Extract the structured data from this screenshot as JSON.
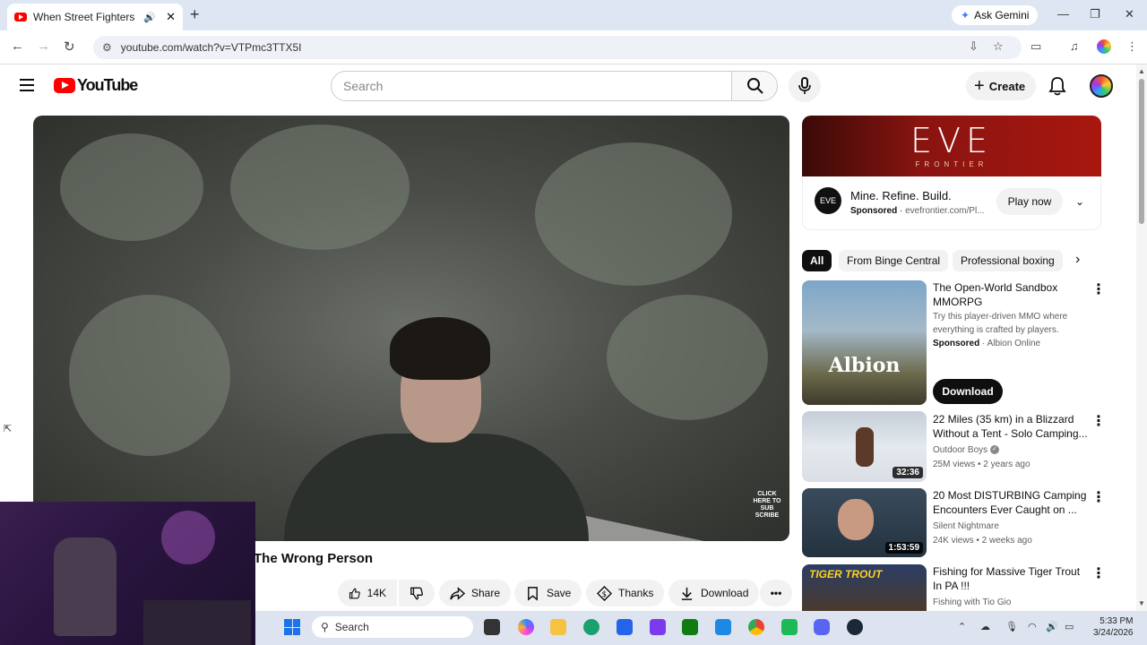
{
  "browser": {
    "tab_title": "When Street Fighters Mess",
    "tab_audio": "🔊",
    "tab_close": "✕",
    "new_tab": "+",
    "ask_gemini": "Ask Gemini",
    "url": "youtube.com/watch?v=VTPmc3TTX5I",
    "window_min": "—",
    "window_max": "❐",
    "window_close": "✕"
  },
  "youtube": {
    "logo_text": "YouTube",
    "search_placeholder": "Search",
    "create_label": "Create"
  },
  "video": {
    "title": "The Wrong Person",
    "watermark": "CLICK HERE TO SUB SCRIBE",
    "actions": {
      "likes": "14K",
      "share": "Share",
      "save": "Save",
      "thanks": "Thanks",
      "download": "Download"
    }
  },
  "ad": {
    "banner_title": "EVE",
    "banner_subtitle": "FRONTIER",
    "logo": "EVE",
    "headline": "Mine. Refine. Build.",
    "sponsored": "Sponsored",
    "domain": "evefrontier.com/Pl...",
    "cta": "Play now"
  },
  "chips": [
    "All",
    "From Binge Central",
    "Professional boxing"
  ],
  "recommendations": [
    {
      "title": "The Open-World Sandbox MMORPG",
      "description": "Try this player-driven MMO where everything is crafted by players.",
      "sponsored": "Sponsored",
      "advertiser": "Albion Online",
      "thumb_text": "Albion",
      "cta": "Download"
    },
    {
      "title": "22 Miles (35 km) in a Blizzard Without a Tent - Solo Camping...",
      "channel": "Outdoor Boys",
      "meta": "25M views • 2 years ago",
      "duration": "32:36"
    },
    {
      "title": "20 Most DISTURBING Camping Encounters Ever Caught on ...",
      "channel": "Silent Nightmare",
      "meta": "24K views • 2 weeks ago",
      "duration": "1:53:59"
    },
    {
      "title": "Fishing for Massive Tiger Trout In PA !!!",
      "channel": "Fishing with Tio Gio",
      "thumb_text": "TIGER TROUT"
    }
  ],
  "taskbar": {
    "search_label": "Search",
    "time": "5:33 PM",
    "date": "3/24/2026"
  },
  "colors": {
    "youtube_red": "#ff0000",
    "chip_active": "#0f0f0f",
    "taskbar": "#dde4f0",
    "tabbar": "#dfe6f3"
  }
}
